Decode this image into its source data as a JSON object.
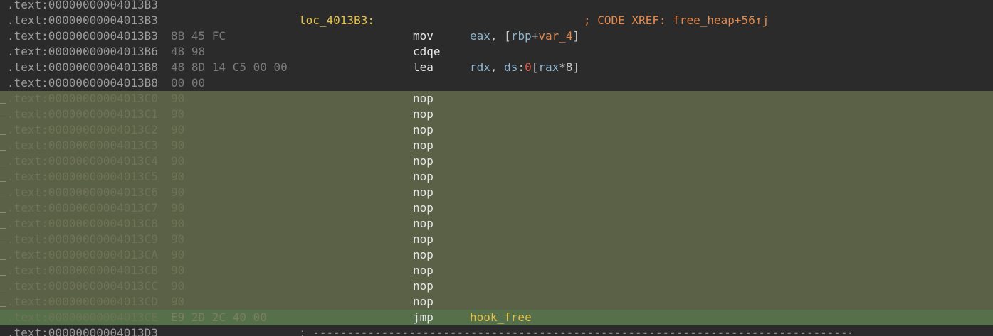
{
  "colors": {
    "background": "#2b2b2b",
    "nop_highlight": "#5b6146",
    "jmp_highlight": "#55704a",
    "label": "#e4c24a",
    "comment": "#e48a4e",
    "register": "#8fb6d0"
  },
  "lines": [
    {
      "addr": ".text:00000000004013B3",
      "bytes": ""
    },
    {
      "addr": ".text:00000000004013B3",
      "bytes": "",
      "label": "loc_4013B3:",
      "comment": "; CODE XREF: free_heap+56↑j"
    },
    {
      "addr": ".text:00000000004013B3",
      "bytes": "8B 45 FC",
      "mnemonic": "mov",
      "op_reg1": "eax",
      "op_mid1": ", [",
      "op_reg2": "rbp",
      "op_mid2": "+",
      "op_var": "var_4",
      "op_end": "]"
    },
    {
      "addr": ".text:00000000004013B6",
      "bytes": "48 98",
      "mnemonic": "cdqe"
    },
    {
      "addr": ".text:00000000004013B8",
      "bytes": "48 8D 14 C5 00 00",
      "mnemonic": "lea",
      "op_reg1": "rdx",
      "op_mid1": ", ",
      "op_reg2": "ds",
      "op_mid2": ":",
      "op_num": "0",
      "op_mid3": "[",
      "op_reg3": "rax",
      "op_end": "*8]"
    },
    {
      "addr": ".text:00000000004013B8",
      "bytes": "00 00"
    },
    {
      "addr": ".text:00000000004013C0",
      "bytes": "90",
      "mnemonic": "nop"
    },
    {
      "addr": ".text:00000000004013C1",
      "bytes": "90",
      "mnemonic": "nop"
    },
    {
      "addr": ".text:00000000004013C2",
      "bytes": "90",
      "mnemonic": "nop"
    },
    {
      "addr": ".text:00000000004013C3",
      "bytes": "90",
      "mnemonic": "nop"
    },
    {
      "addr": ".text:00000000004013C4",
      "bytes": "90",
      "mnemonic": "nop"
    },
    {
      "addr": ".text:00000000004013C5",
      "bytes": "90",
      "mnemonic": "nop"
    },
    {
      "addr": ".text:00000000004013C6",
      "bytes": "90",
      "mnemonic": "nop"
    },
    {
      "addr": ".text:00000000004013C7",
      "bytes": "90",
      "mnemonic": "nop"
    },
    {
      "addr": ".text:00000000004013C8",
      "bytes": "90",
      "mnemonic": "nop"
    },
    {
      "addr": ".text:00000000004013C9",
      "bytes": "90",
      "mnemonic": "nop"
    },
    {
      "addr": ".text:00000000004013CA",
      "bytes": "90",
      "mnemonic": "nop"
    },
    {
      "addr": ".text:00000000004013CB",
      "bytes": "90",
      "mnemonic": "nop"
    },
    {
      "addr": ".text:00000000004013CC",
      "bytes": "90",
      "mnemonic": "nop"
    },
    {
      "addr": ".text:00000000004013CD",
      "bytes": "90",
      "mnemonic": "nop"
    },
    {
      "addr": ".text:00000000004013CE",
      "bytes": "E9 2D 2C 40 00",
      "mnemonic": "jmp",
      "op_sym": "hook_free"
    },
    {
      "addr": ".text:00000000004013D3",
      "bytes": "",
      "separator": "; -----------------------------------------------------------------------------------------------"
    }
  ]
}
